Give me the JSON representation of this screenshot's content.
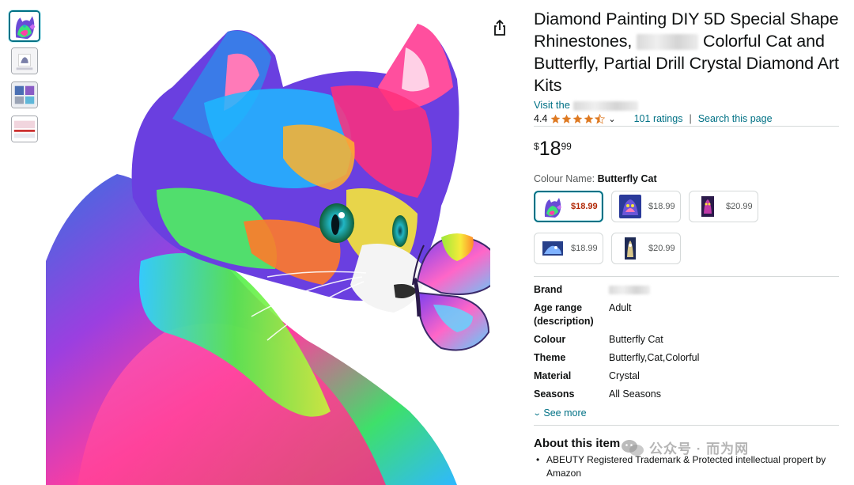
{
  "product": {
    "title_part1": "Diamond Painting DIY 5D Special Shape Rhinestones,",
    "title_part2": "Colorful Cat and Butterfly, Partial Drill Crystal Diamond Art Kits",
    "store_prefix": "Visit the",
    "rating_value": "4.4",
    "ratings_count": "101 ratings",
    "search_page": "Search this page",
    "price": {
      "symbol": "$",
      "whole": "18",
      "fraction": "99"
    },
    "colour_label": "Colour Name:",
    "colour_value": "Butterfly Cat",
    "swatches": [
      {
        "price": "$18.99",
        "selected": true
      },
      {
        "price": "$18.99",
        "selected": false
      },
      {
        "price": "$20.99",
        "selected": false
      },
      {
        "price": "$18.99",
        "selected": false
      },
      {
        "price": "$20.99",
        "selected": false
      }
    ],
    "specs": [
      {
        "key": "Brand",
        "value": ""
      },
      {
        "key": "Age range (description)",
        "value": "Adult"
      },
      {
        "key": "Colour",
        "value": "Butterfly Cat"
      },
      {
        "key": "Theme",
        "value": "Butterfly,Cat,Colorful"
      },
      {
        "key": "Material",
        "value": "Crystal"
      },
      {
        "key": "Seasons",
        "value": "All Seasons"
      }
    ],
    "see_more": "See more",
    "about_heading": "About this item",
    "about_bullet_1": "ABEUTY Registered Trademark & Protected intellectual propert by Amazon"
  },
  "watermark": "公众号 · 而为网",
  "colors": {
    "link": "#007185",
    "star": "#de7921",
    "price_red": "#b12704"
  },
  "icons": [
    "share-icon",
    "star-icon",
    "chevron-down-icon",
    "wechat-icon"
  ]
}
